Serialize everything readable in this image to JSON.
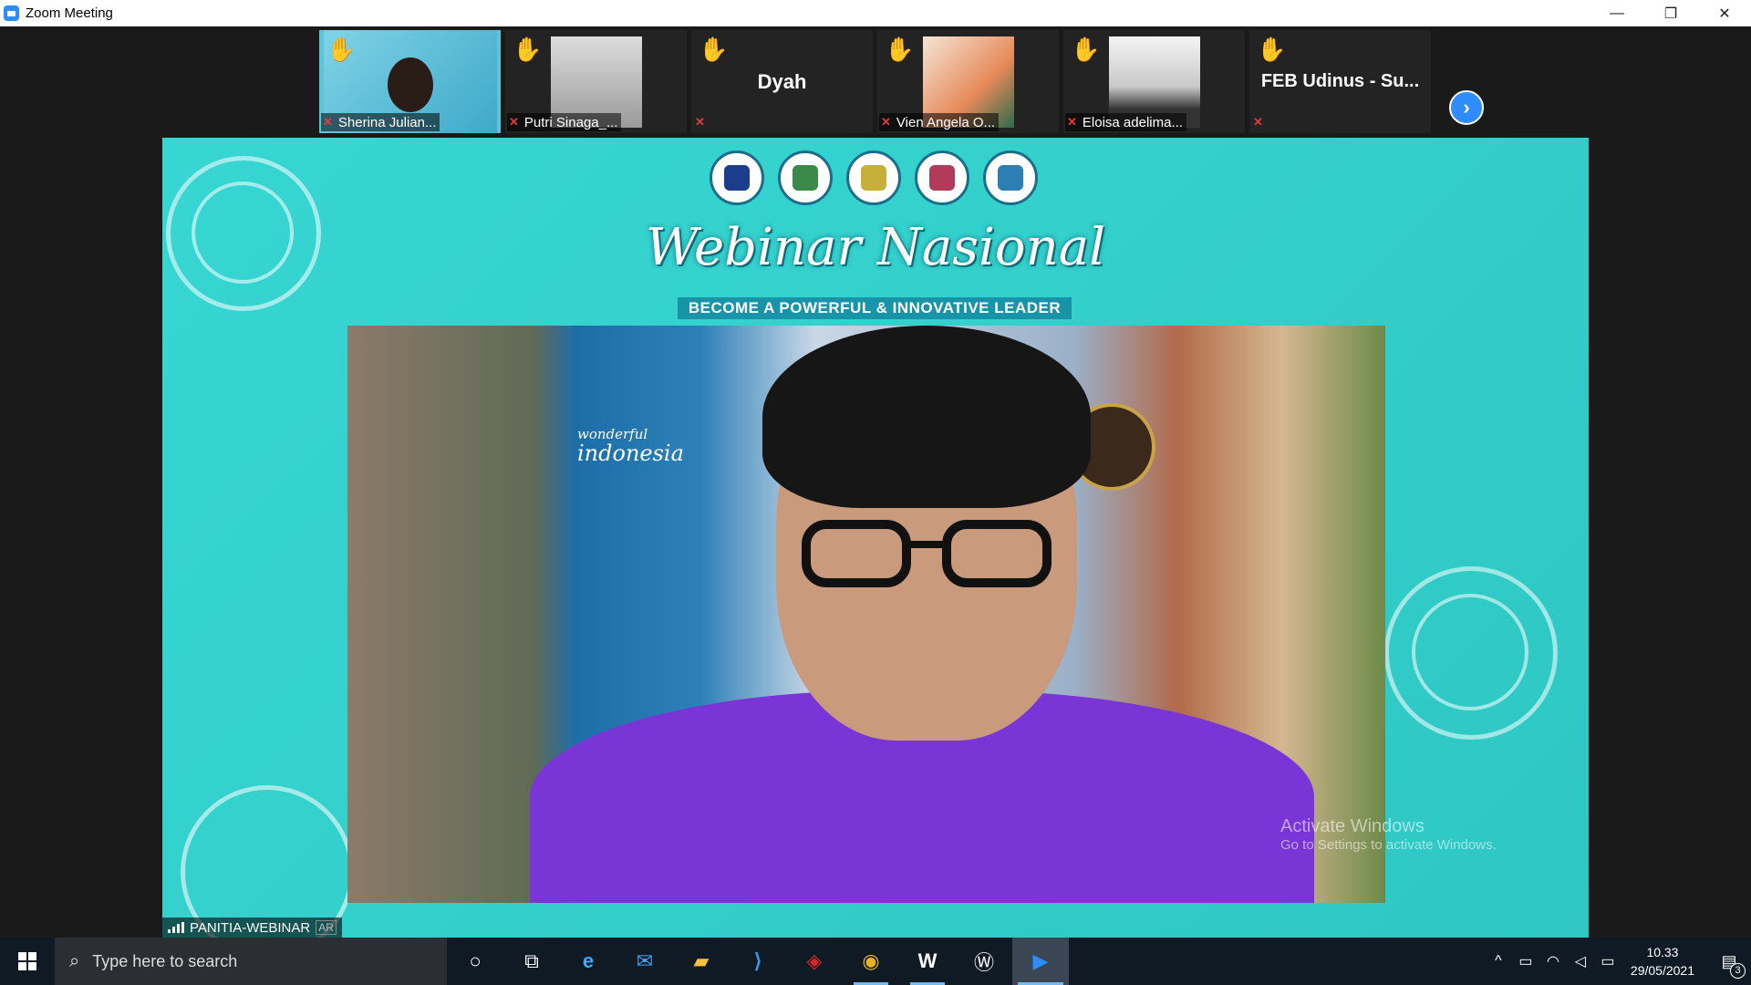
{
  "window": {
    "title": "Zoom Meeting",
    "minimize": "—",
    "restore": "❐",
    "close": "✕"
  },
  "participants": [
    {
      "name": "Sherina Julian...",
      "muted": true,
      "hand_raised": true,
      "video": true
    },
    {
      "name": "Putri Sinaga_...",
      "muted": true,
      "hand_raised": true,
      "video": true
    },
    {
      "name": "Dyah",
      "muted": true,
      "hand_raised": true,
      "video": false
    },
    {
      "name": "Vien Angela O...",
      "muted": true,
      "hand_raised": true,
      "video": true
    },
    {
      "name": "Eloisa adelima...",
      "muted": true,
      "hand_raised": true,
      "video": true
    },
    {
      "name": "FEB Udinus - Su...",
      "muted": true,
      "hand_raised": true,
      "video": false
    }
  ],
  "strip": {
    "next_arrow": "›"
  },
  "main_video": {
    "title": "Webinar Nasional",
    "subtitle": "BECOME A POWERFUL & INNOVATIVE LEADER",
    "background_text_line1": "wonderful",
    "background_text_line2": "indonesia",
    "speaker_name": "PANITIA-WEBINAR",
    "speaker_badge": "AR",
    "watermark_title": "Activate Windows",
    "watermark_sub": "Go to Settings to activate Windows."
  },
  "taskbar": {
    "search_placeholder": "Type here to search",
    "apps": [
      {
        "name": "cortana",
        "glyph": "○"
      },
      {
        "name": "task-view",
        "glyph": "⧉"
      },
      {
        "name": "edge",
        "glyph": "e"
      },
      {
        "name": "mail",
        "glyph": "✉"
      },
      {
        "name": "file-explorer",
        "glyph": "▰"
      },
      {
        "name": "vscode",
        "glyph": "⟩"
      },
      {
        "name": "dragon-app",
        "glyph": "◈"
      },
      {
        "name": "chrome",
        "glyph": "◉"
      },
      {
        "name": "word",
        "glyph": "W"
      },
      {
        "name": "app-w",
        "glyph": "Ⓦ"
      },
      {
        "name": "zoom",
        "glyph": "▶"
      }
    ],
    "time": "10.33",
    "date": "29/05/2021",
    "notification_count": "3"
  },
  "colors": {
    "zoom_blue": "#2d8cff",
    "video_teal": "#37d6d2",
    "muted_red": "#e03b3b",
    "hand_yellow": "#f5c518",
    "taskbar_bg": "#101a24"
  }
}
